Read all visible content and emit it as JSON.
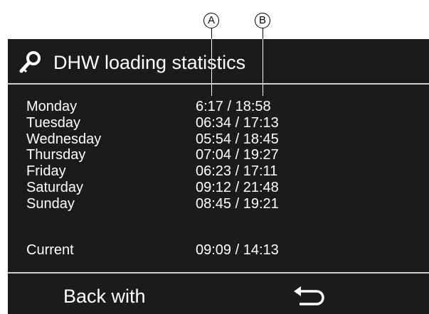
{
  "callouts": {
    "a": "A",
    "b": "B"
  },
  "header": {
    "icon": "key-icon",
    "title": "DHW loading statistics"
  },
  "days": [
    "Monday",
    "Tuesday",
    "Wednesday",
    "Thursday",
    "Friday",
    "Saturday",
    "Sunday"
  ],
  "times": [
    "6:17 / 18:58",
    "06:34 / 17:13",
    "05:54 / 18:45",
    "07:04 / 19:27",
    "06:23 / 17:11",
    "09:12 / 21:48",
    "08:45 / 19:21"
  ],
  "current": {
    "label": "Current",
    "value": "09:09 / 14:13"
  },
  "footer": {
    "back_label": "Back with",
    "back_icon": "return-arrow-icon"
  },
  "colors": {
    "screen_bg": "#1b1b1b",
    "text": "#ffffff",
    "divider": "#cfcfcf"
  }
}
